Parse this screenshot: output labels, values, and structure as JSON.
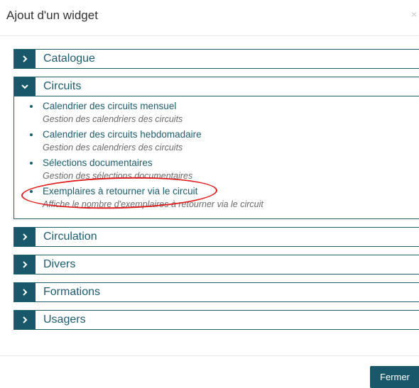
{
  "modal": {
    "title": "Ajout d'un widget",
    "close_glyph": "×"
  },
  "sections": [
    {
      "label": "Catalogue",
      "expanded": false
    },
    {
      "label": "Circuits",
      "expanded": true
    },
    {
      "label": "Circulation",
      "expanded": false
    },
    {
      "label": "Divers",
      "expanded": false
    },
    {
      "label": "Formations",
      "expanded": false
    },
    {
      "label": "Usagers",
      "expanded": false
    }
  ],
  "circuits_widgets": [
    {
      "title": "Calendrier des circuits mensuel",
      "description": "Gestion des calendriers des circuits"
    },
    {
      "title": "Calendrier des circuits hebdomadaire",
      "description": "Gestion des calendriers des circuits"
    },
    {
      "title": "Sélections documentaires",
      "description": "Gestion des sélections documentaires"
    },
    {
      "title": "Exemplaires à retourner via le circuit",
      "description": "Affiche le nombre d'exemplaires à retourner via le circuit"
    }
  ],
  "footer": {
    "close_label": "Fermer"
  },
  "colors": {
    "accent": "#18586a",
    "highlight": "#e11b1b"
  },
  "icons": {
    "collapsed": "chevron-right-icon",
    "expanded": "chevron-down-icon"
  }
}
